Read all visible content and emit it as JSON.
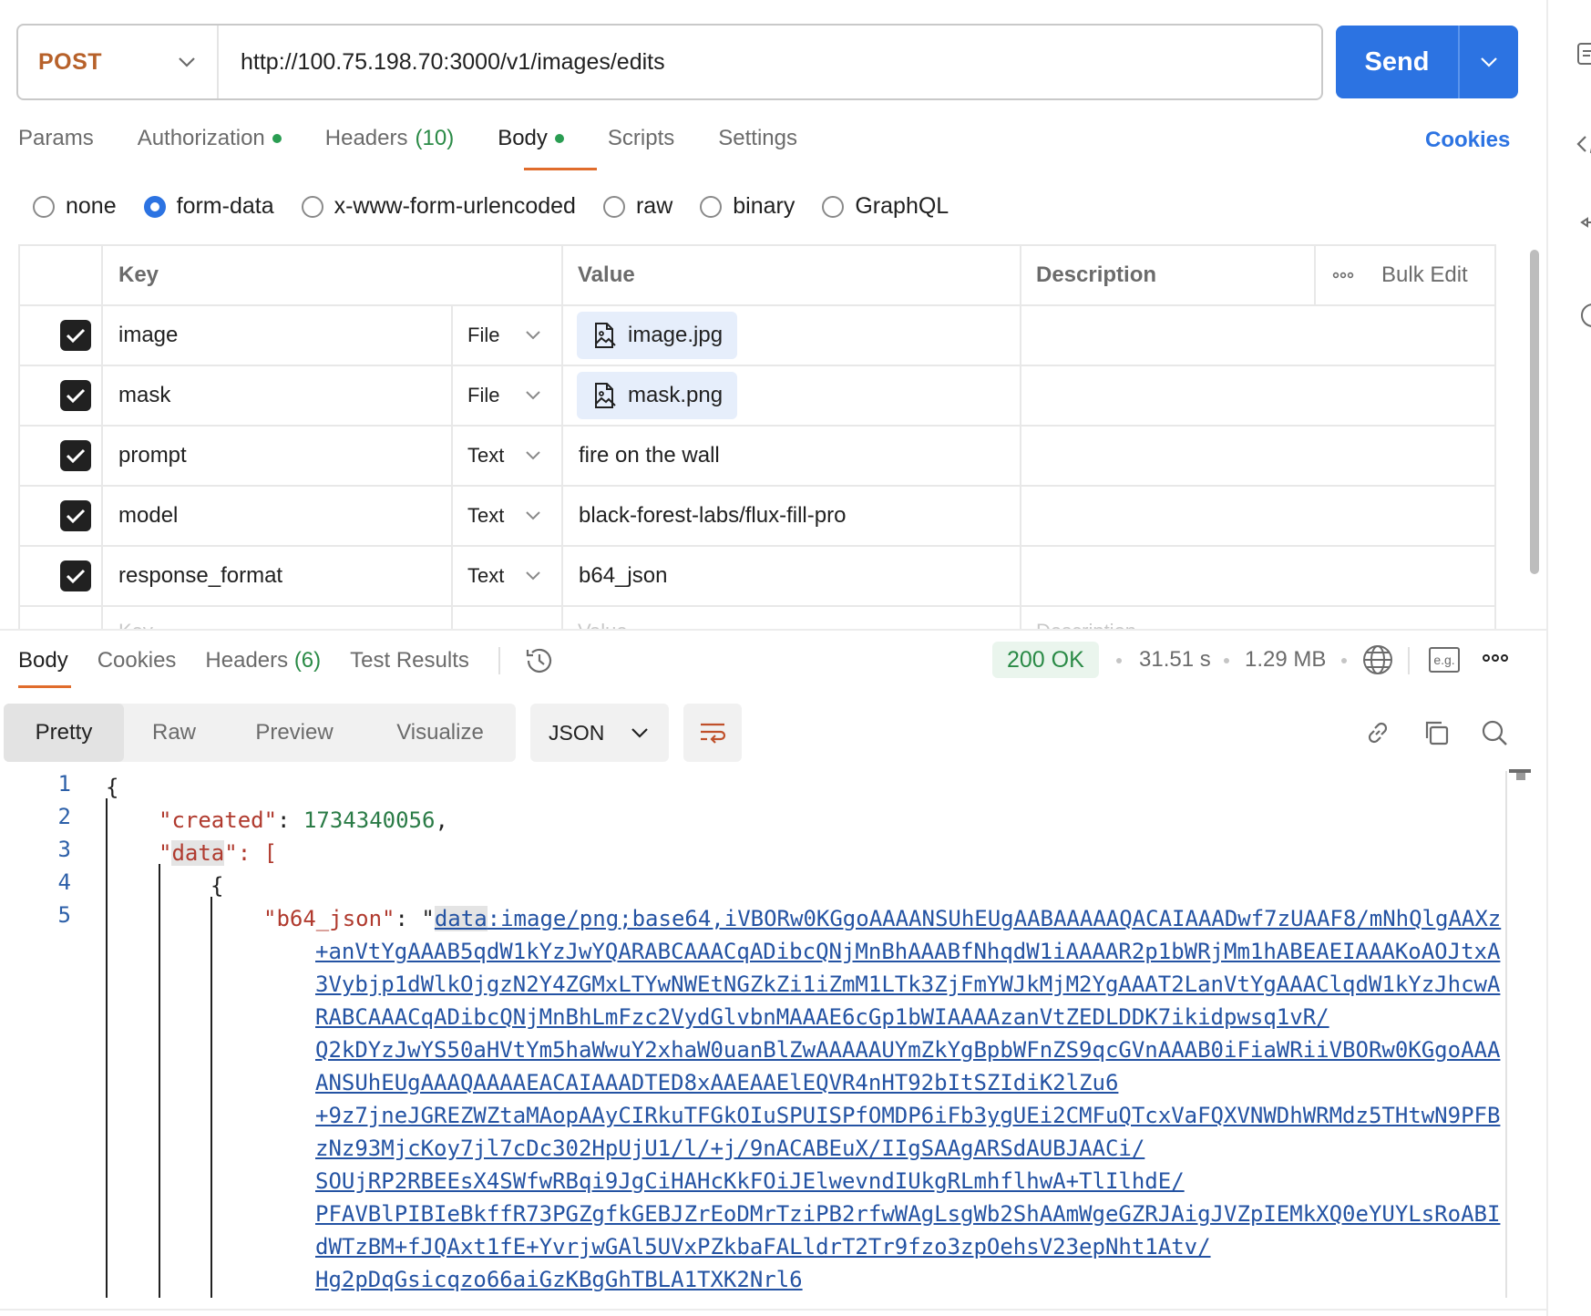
{
  "request": {
    "method": "POST",
    "url": "http://100.75.198.70:3000/v1/images/edits",
    "send_label": "Send"
  },
  "request_tabs": [
    {
      "label": "Params"
    },
    {
      "label": "Authorization"
    },
    {
      "label": "Headers",
      "count": "(10)"
    },
    {
      "label": "Body"
    },
    {
      "label": "Scripts"
    },
    {
      "label": "Settings"
    }
  ],
  "cookies_label": "Cookies",
  "body_types": [
    "none",
    "form-data",
    "x-www-form-urlencoded",
    "raw",
    "binary",
    "GraphQL"
  ],
  "selected_body_type": "form-data",
  "table": {
    "headers": {
      "key": "Key",
      "value": "Value",
      "description": "Description",
      "bulk_edit": "Bulk Edit"
    },
    "rows": [
      {
        "key": "image",
        "type": "File",
        "value": "image.jpg"
      },
      {
        "key": "mask",
        "type": "File",
        "value": "mask.png"
      },
      {
        "key": "prompt",
        "type": "Text",
        "value": "fire on the wall"
      },
      {
        "key": "model",
        "type": "Text",
        "value": "black-forest-labs/flux-fill-pro"
      },
      {
        "key": "response_format",
        "type": "Text",
        "value": "b64_json"
      }
    ],
    "placeholder": {
      "key": "Key",
      "value": "Value",
      "description": "Description"
    }
  },
  "response_tabs": [
    {
      "label": "Body"
    },
    {
      "label": "Cookies"
    },
    {
      "label": "Headers",
      "count": "(6)"
    },
    {
      "label": "Test Results"
    }
  ],
  "response_meta": {
    "status": "200 OK",
    "time": "31.51 s",
    "size": "1.29 MB",
    "example_label": "e.g."
  },
  "view_modes": [
    "Pretty",
    "Raw",
    "Preview",
    "Visualize"
  ],
  "format": "JSON",
  "code": {
    "line_numbers": [
      "1",
      "2",
      "3",
      "4",
      "5"
    ],
    "brace_open": "{",
    "created_key": "\"created\"",
    "created_value": "1734340056",
    "data_key_q": "\"",
    "data_key": "data",
    "data_open": "\": [",
    "inner_brace": "{",
    "b64_key": "\"b64_json\"",
    "b64_colon": ": \"",
    "b64_prefix_hl": "data",
    "b64_prefix_rest": ":image",
    "b64_lines": [
      "/png;base64,iVBORw0KGgoAAAANSUhEUgAABAAAAAQACAIAAADwf7zUAAF8/mNhQlgAAXz",
      "+anVtYgAAAB5qdW1kYzJwYQARABCAAACqADibcQNjMnBhAAABfNhqdW1iAAAAR2p1bWRjMm1hABEAEIAAAKoAOJtxA",
      "3Vybjp1dWlkOjgzN2Y4ZGMxLTYwNWEtNGZkZi1iZmM1LTk3ZjFmYWJkMjM2YgAAAT2LanVtYgAAAClqdW1kYzJhcwA",
      "RABCAAACqADibcQNjMnBhLmFzc2VydGlvbnMAAAE6cGp1bWIAAAAzanVtZEDLDDK7ikidpwsq1vR/",
      "Q2kDYzJwYS50aHVtYm5haWwuY2xhaW0uanBlZwAAAAAUYmZkYgBpbWFnZS9qcGVnAAAB0iFiaWRiiVBORw0KGgoAAA",
      "ANSUhEUgAAAQAAAAEACAIAAADTED8xAAEAAElEQVR4nHT92bItSZIdiK2lZu6",
      "+9z7jneJGREZWZtaMAopAAyCIRkuTFGkOIuSPUISPfOMDP6iFb3ygUEi2CMFuQTcxVaFQXVNWDhWRMdz5THtwN9PFB",
      "zNz93MjcKoy7jl7cDc302HpUjU1/l/+j/9nACABEuX/IIgSAAgARSdAUBJAACi/",
      "SOUjRP2RBEEsX4SWfwRBqi9JgCiHAHcKkFOiJElwevndIUkgRLmhflhwA+TlIlhdE/",
      "PFAVBlPIBIeBkffR73PGZgfkGEBJZrEoDMrTziPB2rfwWAgLsgWb2ShAAmWgeGZRJAigJVZpIEMkXQ0eYUYLsRoABI",
      "dWTzBM+fJQAxt1fE+YvrjwGAl5UVxPZkbaFALldrT2Tr9fzo3zpOehsV23epNht1Atv/",
      "Hg2pDqGsicqzo66aiGzKBgGhTBLA1TXK2Nrl6"
    ]
  }
}
